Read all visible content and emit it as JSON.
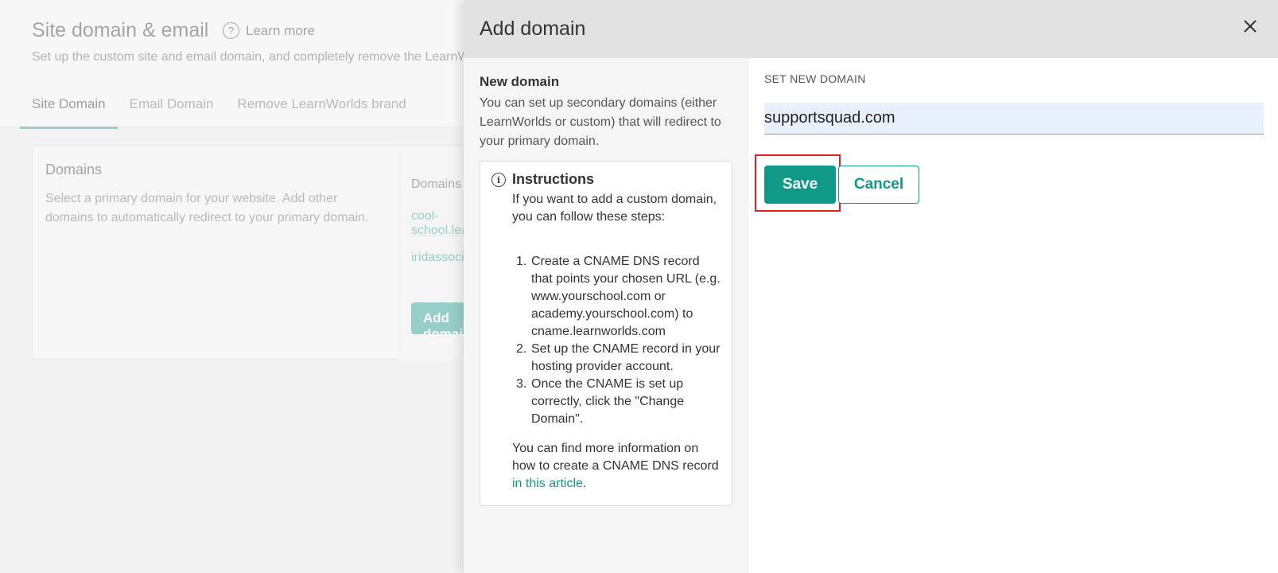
{
  "background": {
    "title": "Site domain & email",
    "learn_more": "Learn more",
    "help_icon_glyph": "?",
    "subtitle": "Set up the custom site and email domain, and completely remove the LearnWorlds brand",
    "tabs": [
      {
        "label": "Site Domain",
        "active": true
      },
      {
        "label": "Email Domain",
        "active": false
      },
      {
        "label": "Remove LearnWorlds brand",
        "active": false
      }
    ],
    "card": {
      "title": "Domains",
      "description": "Select a primary domain for your website. Add other domains to automatically redirect to your primary domain.",
      "column_header": "Domains",
      "domains": [
        "cool-school.learnworlds.com",
        "iridassociates.com"
      ],
      "add_button": "Add domain"
    }
  },
  "modal": {
    "title": "Add domain",
    "close_icon": "close-icon",
    "new_domain": {
      "title": "New domain",
      "description": "You can set up secondary domains (either LearnWorlds or custom) that will redirect to your primary domain."
    },
    "instructions": {
      "icon_glyph": "i",
      "title": "Instructions",
      "intro": "If you want to add a custom domain, you can follow these steps:",
      "steps": [
        {
          "num": "1.",
          "text": "Create a CNAME DNS record that points your chosen URL (e.g. www.yourschool.com or academy.yourschool.com) to cname.learnworlds.com"
        },
        {
          "num": "2.",
          "text": "Set up the CNAME record in your hosting provider account."
        },
        {
          "num": "3.",
          "text": "Once the CNAME is set up correctly, click the \"Change Domain\"."
        }
      ],
      "footer_text": "You can find more information on how to create a CNAME DNS record ",
      "footer_link": "in this article",
      "footer_end": "."
    },
    "form": {
      "label": "SET NEW DOMAIN",
      "domain_value": "supportsquad.com",
      "save_label": "Save",
      "cancel_label": "Cancel"
    }
  },
  "colors": {
    "accent": "#119988",
    "highlight": "#e02020"
  }
}
